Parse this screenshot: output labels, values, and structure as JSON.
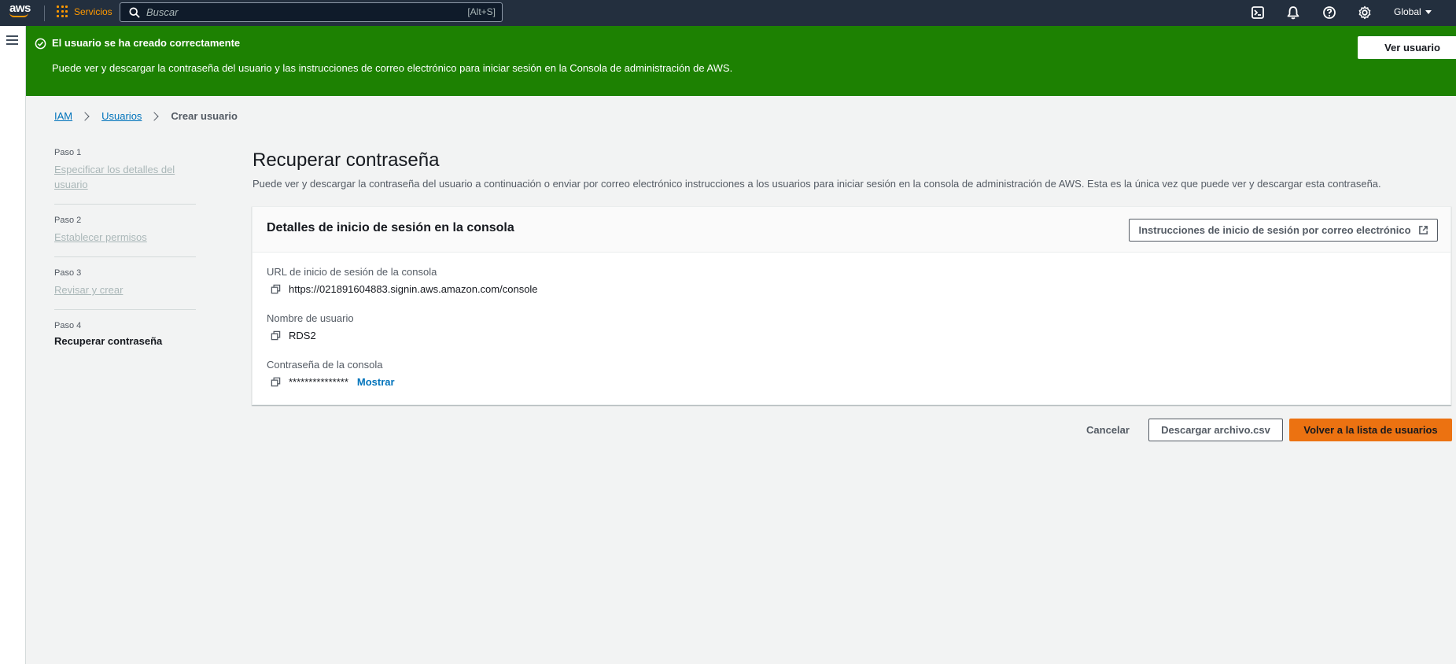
{
  "topnav": {
    "logo": "aws",
    "services_label": "Servicios",
    "search_placeholder": "Buscar",
    "search_shortcut": "[Alt+S]",
    "region_label": "Global",
    "icons": [
      "cloudshell-icon",
      "bell-icon",
      "help-icon",
      "gear-icon"
    ]
  },
  "flash": {
    "title": "El usuario se ha creado correctamente",
    "message": "Puede ver y descargar la contraseña del usuario y las instrucciones de correo electrónico para iniciar sesión en la Consola de administración de AWS.",
    "button_label": "Ver usuario",
    "color": "#1d8102"
  },
  "breadcrumb": {
    "items": [
      "IAM",
      "Usuarios"
    ],
    "current": "Crear usuario"
  },
  "steps": [
    {
      "num": "Paso 1",
      "label": "Especificar los detalles del usuario"
    },
    {
      "num": "Paso 2",
      "label": "Establecer permisos"
    },
    {
      "num": "Paso 3",
      "label": "Revisar y crear"
    },
    {
      "num": "Paso 4",
      "label": "Recuperar contraseña"
    }
  ],
  "page": {
    "title": "Recuperar contraseña",
    "description": "Puede ver y descargar la contraseña del usuario a continuación o enviar por correo electrónico instrucciones a los usuarios para iniciar sesión en la consola de administración de AWS. Esta es la única vez que puede ver y descargar esta contraseña."
  },
  "panel": {
    "title": "Detalles de inicio de sesión en la consola",
    "email_button": "Instrucciones de inicio de sesión por correo electrónico",
    "fields": [
      {
        "label": "URL de inicio de sesión de la consola",
        "value": "https://021891604883.signin.aws.amazon.com/console"
      },
      {
        "label": "Nombre de usuario",
        "value": "RDS2"
      },
      {
        "label": "Contraseña de la consola",
        "value": "***************",
        "action": "Mostrar"
      }
    ]
  },
  "footer": {
    "cancel": "Cancelar",
    "download": "Descargar archivo.csv",
    "primary": "Volver a la lista de usuarios",
    "accent": "#ec7211"
  }
}
